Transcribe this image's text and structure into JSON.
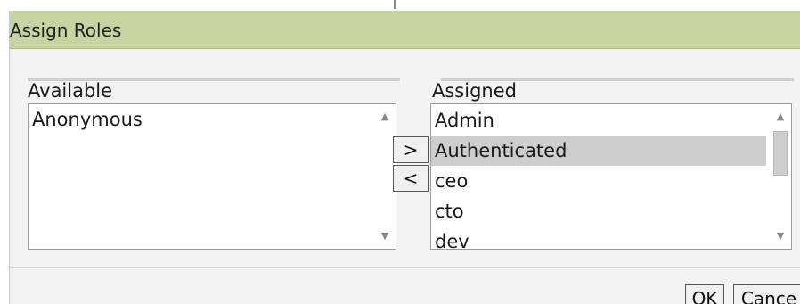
{
  "dialog": {
    "title": "Assign Roles"
  },
  "available": {
    "label": "Available",
    "items": [
      "Anonymous"
    ]
  },
  "assigned": {
    "label": "Assigned",
    "items": [
      "Admin",
      "Authenticated",
      "ceo",
      "cto",
      "dev"
    ],
    "selected": "Authenticated"
  },
  "controls": {
    "add_label": ">",
    "remove_label": "<"
  },
  "footer": {
    "ok_label": "OK",
    "cancel_label": "Cance"
  },
  "icons": {
    "scroll_up": "triangle-up",
    "scroll_down": "triangle-down"
  },
  "colors": {
    "titlebar": "#c6d4a2",
    "selection": "#cdcdcd",
    "dialog_background": "#f3f3f3"
  }
}
